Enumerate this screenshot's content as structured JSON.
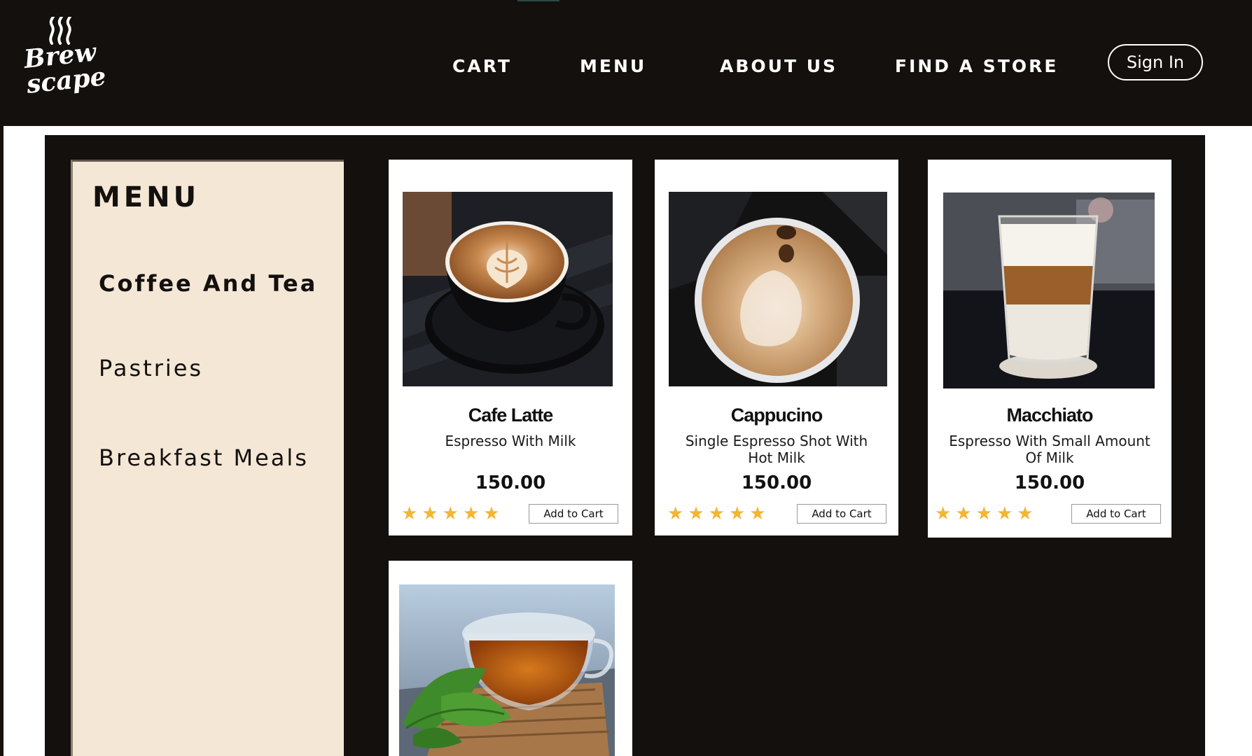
{
  "brand": {
    "logo_line1": "Brew",
    "logo_line2": "scape"
  },
  "nav": {
    "cart": "CART",
    "menu": "MENU",
    "about": "ABOUT US",
    "find_store": "FIND A STORE",
    "sign_in": "Sign In"
  },
  "sidebar": {
    "title": "MENU",
    "items": [
      {
        "label": "Coffee And Tea",
        "active": true
      },
      {
        "label": "Pastries",
        "active": false
      },
      {
        "label": "Breakfast Meals",
        "active": false
      }
    ]
  },
  "products": [
    {
      "name": "Cafe Latte",
      "description": "Espresso With Milk",
      "price": "150.00",
      "rating": 5,
      "button": "Add to Cart",
      "image": "latte-image"
    },
    {
      "name": "Cappucino",
      "description": "Single Espresso Shot With Hot Milk",
      "price": "150.00",
      "rating": 5,
      "button": "Add to Cart",
      "image": "cappuccino-image"
    },
    {
      "name": "Macchiato",
      "description": "Espresso With Small Amount Of Milk",
      "price": "150.00",
      "rating": 5,
      "button": "Add to Cart",
      "image": "macchiato-image"
    },
    {
      "name": "",
      "description": "",
      "price": "",
      "rating": 0,
      "button": "",
      "image": "tea-image"
    }
  ],
  "colors": {
    "header_bg": "#13100d",
    "sidebar_bg": "#f4e7d6",
    "star": "#f2b632"
  }
}
